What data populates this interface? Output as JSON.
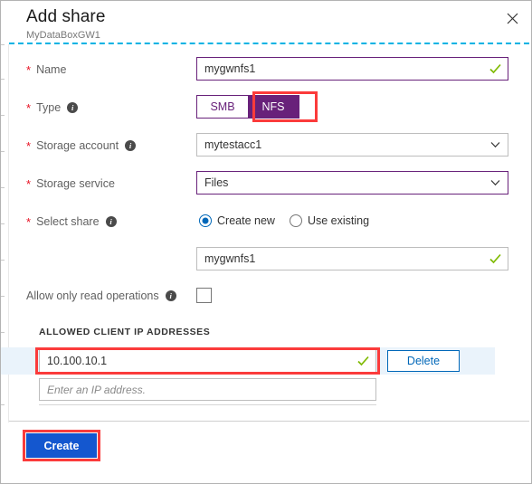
{
  "window": {
    "title": "Add share",
    "subtitle": "MyDataBoxGW1",
    "close_icon": "close-icon"
  },
  "form": {
    "name": {
      "label": "Name",
      "required_marker": "*",
      "value": "mygwnfs1",
      "valid_icon": "checkmark-icon"
    },
    "type": {
      "label": "Type",
      "required_marker": "*",
      "info_icon": "info-icon",
      "options": [
        "SMB",
        "NFS"
      ],
      "selected": "NFS"
    },
    "storage_account": {
      "label": "Storage account",
      "required_marker": "*",
      "info_icon": "info-icon",
      "value": "mytestacc1",
      "chevron_icon": "chevron-down-icon"
    },
    "storage_service": {
      "label": "Storage service",
      "required_marker": "*",
      "value": "Files",
      "chevron_icon": "chevron-down-icon"
    },
    "select_share": {
      "label": "Select share",
      "required_marker": "*",
      "info_icon": "info-icon",
      "options": [
        "Create new",
        "Use existing"
      ],
      "selected": "Create new"
    },
    "share_name": {
      "value": "mygwnfs1",
      "valid_icon": "checkmark-icon"
    },
    "read_only": {
      "label": "Allow only read operations",
      "info_icon": "info-icon",
      "checked": false
    }
  },
  "ip_section": {
    "heading": "ALLOWED CLIENT IP ADDRESSES",
    "rows": [
      {
        "value": "10.100.10.1",
        "valid_icon": "checkmark-icon",
        "delete_label": "Delete",
        "highlighted": true
      }
    ],
    "new_row_placeholder": "Enter an IP address."
  },
  "footer": {
    "create_label": "Create",
    "highlighted": true
  },
  "colors": {
    "accent_purple": "#68217a",
    "accent_blue": "#1457cf",
    "link_blue": "#0067b8",
    "valid_green": "#7fba00",
    "highlight_red": "#fb3b3b",
    "dotted_rule_cyan": "#00b2e3",
    "row_highlight_bg": "#eaf3fb"
  }
}
